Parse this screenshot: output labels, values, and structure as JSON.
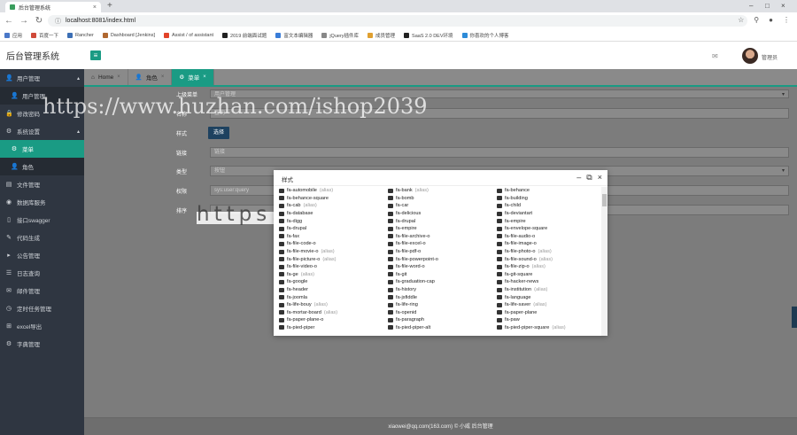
{
  "browser": {
    "tab_title": "后台管理系统",
    "url": "localhost:8081/index.html",
    "bookmarks": [
      "应用",
      "百度一下",
      "Rancher",
      "Dashboard [Jenkins]",
      "Assist / of assistant",
      "2019 前端面试题",
      "富文本编辑器",
      "jQuery插件库",
      "成员管理",
      "SaaS 2.0 DEV环境",
      "你喜欢的个人博客"
    ]
  },
  "header": {
    "app_title": "后台管理系统",
    "menu_toggle_icon": "≡",
    "username": "管理员"
  },
  "sidebar": {
    "items": [
      {
        "label": "用户管理",
        "icon": "👤",
        "expanded": true
      },
      {
        "label": "用户管理",
        "icon": "👤",
        "sub": true
      },
      {
        "label": "修改密码",
        "icon": "🔒"
      },
      {
        "label": "系统设置",
        "icon": "⚙",
        "expanded": true
      },
      {
        "label": "菜单",
        "icon": "⚙",
        "sub": true,
        "active": true
      },
      {
        "label": "角色",
        "icon": "👤",
        "sub": true
      },
      {
        "label": "文件管理",
        "icon": "📁"
      },
      {
        "label": "数据库服务",
        "icon": "🗄"
      },
      {
        "label": "接口swagger",
        "icon": "📄"
      },
      {
        "label": "代码生成",
        "icon": "✎"
      },
      {
        "label": "公告管理",
        "icon": "📢"
      },
      {
        "label": "日志查询",
        "icon": "📋"
      },
      {
        "label": "邮件管理",
        "icon": "✉"
      },
      {
        "label": "定时任务管理",
        "icon": "⏱"
      },
      {
        "label": "excel导出",
        "icon": "⊞"
      },
      {
        "label": "字典管理",
        "icon": "⚙"
      }
    ]
  },
  "content_tabs": [
    {
      "label": "Home",
      "icon": "🏠"
    },
    {
      "label": "角色",
      "icon": "👤"
    },
    {
      "label": "菜单",
      "icon": "⚙",
      "active": true
    }
  ],
  "form": {
    "parent_label": "上级菜单",
    "parent_value": "用户管理",
    "name_label": "名称",
    "name_value": "查询",
    "style_label": "样式",
    "choose_button": "选择",
    "link_label": "链接",
    "link_placeholder": "链接",
    "type_label": "类型",
    "type_value": "按钮",
    "perm_label": "权限",
    "perm_value": "sys:user:query",
    "sort_label": "排序"
  },
  "modal": {
    "title": "样式",
    "icons": [
      {
        "name": "fa-automobile",
        "alias": "(alias)"
      },
      {
        "name": "fa-bank",
        "alias": "(alias)"
      },
      {
        "name": "fa-behance",
        "alias": ""
      },
      {
        "name": "fa-behance-square",
        "alias": ""
      },
      {
        "name": "fa-bomb",
        "alias": ""
      },
      {
        "name": "fa-building",
        "alias": ""
      },
      {
        "name": "fa-cab",
        "alias": "(alias)"
      },
      {
        "name": "fa-car",
        "alias": ""
      },
      {
        "name": "fa-child",
        "alias": ""
      },
      {
        "name": "fa-database",
        "alias": ""
      },
      {
        "name": "fa-delicious",
        "alias": ""
      },
      {
        "name": "fa-deviantart",
        "alias": ""
      },
      {
        "name": "fa-digg",
        "alias": ""
      },
      {
        "name": "fa-drupal",
        "alias": ""
      },
      {
        "name": "fa-empire",
        "alias": ""
      },
      {
        "name": "fa-drupal",
        "alias": ""
      },
      {
        "name": "fa-empire",
        "alias": ""
      },
      {
        "name": "fa-envelope-square",
        "alias": ""
      },
      {
        "name": "fa-fax",
        "alias": ""
      },
      {
        "name": "fa-file-archive-o",
        "alias": ""
      },
      {
        "name": "fa-file-audio-o",
        "alias": ""
      },
      {
        "name": "fa-file-code-o",
        "alias": ""
      },
      {
        "name": "fa-file-excel-o",
        "alias": ""
      },
      {
        "name": "fa-file-image-o",
        "alias": ""
      },
      {
        "name": "fa-file-movie-o",
        "alias": "(alias)"
      },
      {
        "name": "fa-file-pdf-o",
        "alias": ""
      },
      {
        "name": "fa-file-photo-o",
        "alias": "(alias)"
      },
      {
        "name": "fa-file-picture-o",
        "alias": "(alias)"
      },
      {
        "name": "fa-file-powerpoint-o",
        "alias": ""
      },
      {
        "name": "fa-file-sound-o",
        "alias": "(alias)"
      },
      {
        "name": "fa-file-video-o",
        "alias": ""
      },
      {
        "name": "fa-file-word-o",
        "alias": ""
      },
      {
        "name": "fa-file-zip-o",
        "alias": "(alias)"
      },
      {
        "name": "fa-ge",
        "alias": "(alias)"
      },
      {
        "name": "fa-git",
        "alias": ""
      },
      {
        "name": "fa-git-square",
        "alias": ""
      },
      {
        "name": "fa-google",
        "alias": ""
      },
      {
        "name": "fa-graduation-cap",
        "alias": ""
      },
      {
        "name": "fa-hacker-news",
        "alias": ""
      },
      {
        "name": "fa-header",
        "alias": ""
      },
      {
        "name": "fa-history",
        "alias": ""
      },
      {
        "name": "fa-institution",
        "alias": "(alias)"
      },
      {
        "name": "fa-joomla",
        "alias": ""
      },
      {
        "name": "fa-jsfiddle",
        "alias": ""
      },
      {
        "name": "fa-language",
        "alias": ""
      },
      {
        "name": "fa-life-bouy",
        "alias": "(alias)"
      },
      {
        "name": "fa-life-ring",
        "alias": ""
      },
      {
        "name": "fa-life-saver",
        "alias": "(alias)"
      },
      {
        "name": "fa-mortar-board",
        "alias": "(alias)"
      },
      {
        "name": "fa-openid",
        "alias": ""
      },
      {
        "name": "fa-paper-plane",
        "alias": ""
      },
      {
        "name": "fa-paper-plane-o",
        "alias": ""
      },
      {
        "name": "fa-paragraph",
        "alias": ""
      },
      {
        "name": "fa-paw",
        "alias": ""
      },
      {
        "name": "fa-pied-piper",
        "alias": ""
      },
      {
        "name": "fa-pied-piper-alt",
        "alias": ""
      },
      {
        "name": "fa-pied-piper-square",
        "alias": "(alias)"
      }
    ]
  },
  "footer": {
    "text": "xiaowei@qq.com(163.com) © 小威 后台管理"
  },
  "watermarks": {
    "top": "https://www.huzhan.com/ishop2039",
    "middle": "https://www.songma.com"
  }
}
